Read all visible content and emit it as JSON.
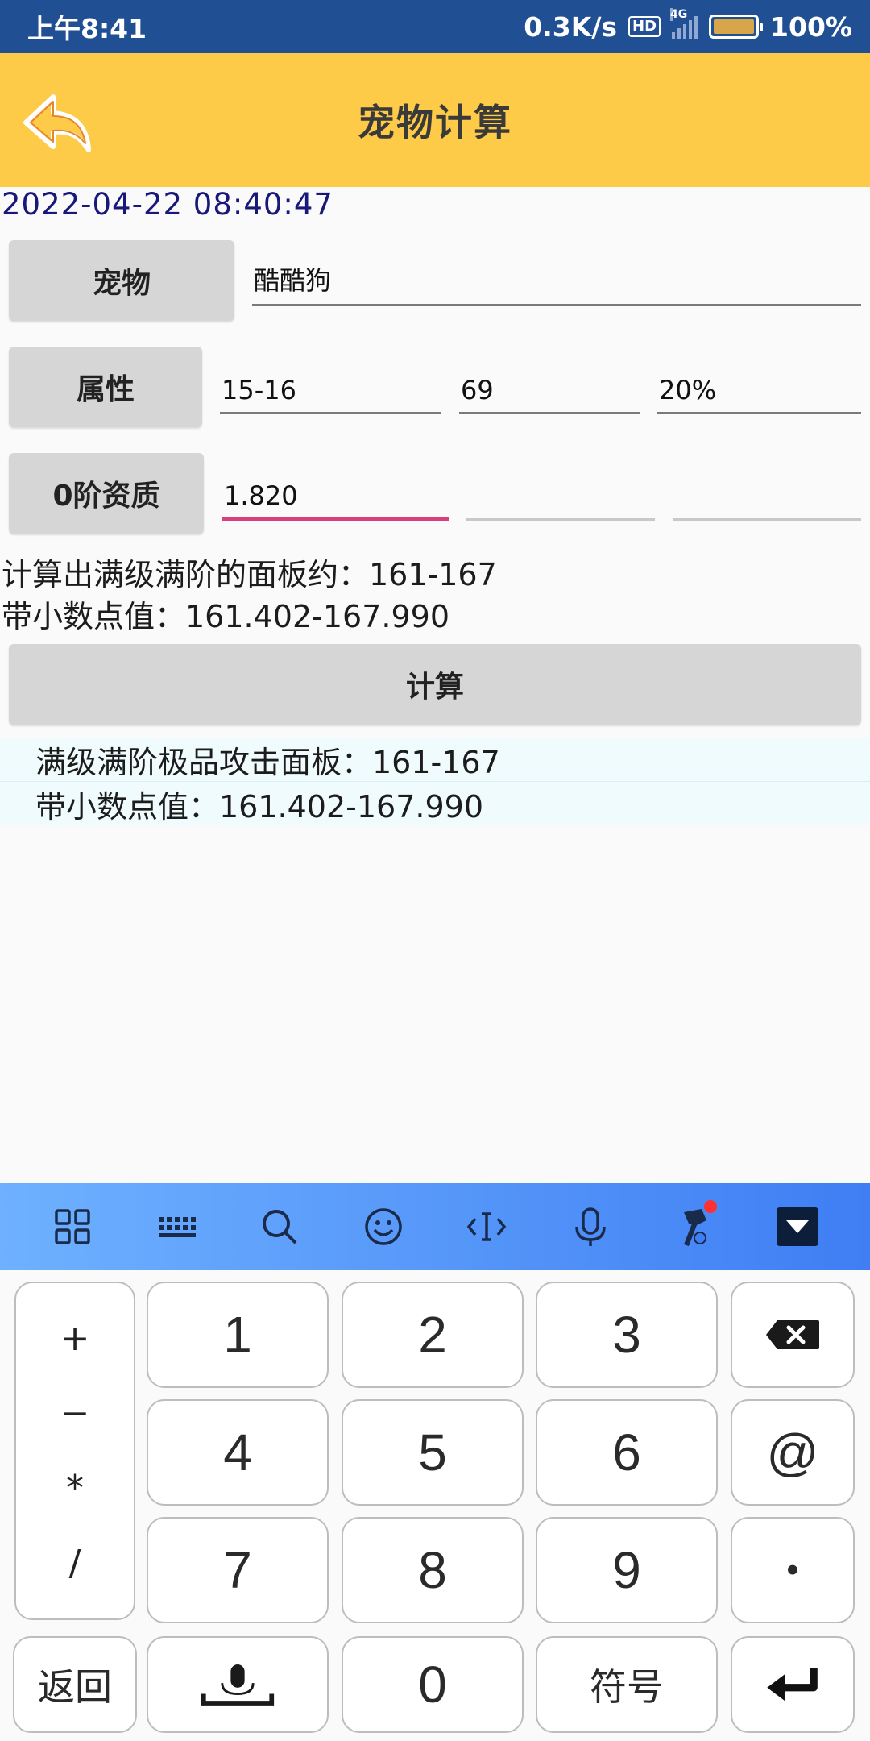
{
  "status_bar": {
    "time": "上午8:41",
    "speed": "0.3K/s",
    "hd": "HD",
    "network": "4G",
    "battery": "100%"
  },
  "header": {
    "title": "宠物计算",
    "back_icon": "back-arrow-icon"
  },
  "datetime": "2022-04-22 08:40:47",
  "pet_row": {
    "label": "宠物",
    "value": "酷酷狗"
  },
  "attr_row": {
    "label": "属性",
    "values": [
      "15-16",
      "69",
      "20%"
    ]
  },
  "quality_row": {
    "label": "0阶资质",
    "values": [
      "1.820",
      "",
      ""
    ]
  },
  "summary": {
    "line1": "计算出满级满阶的面板约：161-167",
    "line2": "带小数点值：161.402-167.990"
  },
  "calculate_button": "计算",
  "results": [
    "满级满阶极品攻击面板：161-167",
    "带小数点值：161.402-167.990"
  ],
  "keyboard": {
    "toolbar_icons": [
      "grid-icon",
      "keyboard-icon",
      "search-icon",
      "emoji-icon",
      "cursor-icon",
      "microphone-icon",
      "hammer-icon",
      "hide-keyboard-icon"
    ],
    "ops": [
      "+",
      "−",
      "*",
      "/"
    ],
    "digits": [
      "1",
      "2",
      "3",
      "4",
      "5",
      "6",
      "7",
      "8",
      "9",
      "0"
    ],
    "at": "@",
    "dot": "•",
    "back": "返回",
    "symbols": "符号"
  },
  "colors": {
    "status_bar": "#204f94",
    "header": "#fdcb47",
    "focus_underline": "#d8407a",
    "datetime": "#18187a",
    "toolbar": "#3f7ef4"
  }
}
